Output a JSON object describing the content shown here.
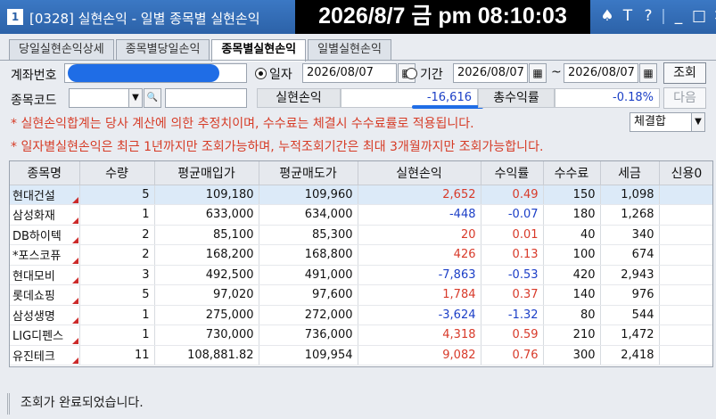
{
  "window": {
    "number": "1",
    "title": "[0328] 실현손익 - 일별 종목별 실현손익",
    "clock": "2026/8/7 금 pm 08:10:03",
    "icons": [
      "font-icon",
      "help-icon",
      "minimize-icon",
      "maximize-icon",
      "close-icon"
    ]
  },
  "tabs": [
    {
      "label": "당일실현손익상세",
      "active": false
    },
    {
      "label": "종목별당일손익",
      "active": false
    },
    {
      "label": "종목별실현손익",
      "active": true
    },
    {
      "label": "일별실현손익",
      "active": false
    }
  ],
  "form": {
    "account_label": "계좌번호",
    "date_radio_label": "일자",
    "date_value": "2026/08/07",
    "period_radio_label": "기간",
    "period_from": "2026/08/07",
    "period_sep": "~",
    "period_to": "2026/08/07",
    "search_button": "조회",
    "code_label": "종목코드",
    "code_value": "",
    "name_value": "",
    "realized_label": "실현손익",
    "realized_value": "-16,616",
    "total_rate_label": "총수익률",
    "total_rate_value": "-0.18%",
    "next_button": "다음",
    "basis_select": "체결합"
  },
  "notices": [
    "* 실현손익합계는 당사 계산에 의한 추정치이며, 수수료는 체결시 수수료률로 적용됩니다.",
    "* 일자별실현손익은 최근 1년까지만 조회가능하며, 누적조회기간은 최대 3개월까지만 조회가능합니다."
  ],
  "table": {
    "columns": [
      "종목명",
      "수량",
      "평균매입가",
      "평균매도가",
      "실현손익",
      "수익률",
      "수수료",
      "세금",
      "신용0"
    ],
    "rows": [
      {
        "name": "현대건설",
        "qty": "5",
        "buy": "109,180",
        "sell": "109,960",
        "pnl": "2,652",
        "rate": "0.49",
        "fee": "150",
        "tax": "1,098",
        "credit": "",
        "sign": "pos"
      },
      {
        "name": "삼성화재",
        "qty": "1",
        "buy": "633,000",
        "sell": "634,000",
        "pnl": "-448",
        "rate": "-0.07",
        "fee": "180",
        "tax": "1,268",
        "credit": "",
        "sign": "neg"
      },
      {
        "name": "DB하이텍",
        "qty": "2",
        "buy": "85,100",
        "sell": "85,300",
        "pnl": "20",
        "rate": "0.01",
        "fee": "40",
        "tax": "340",
        "credit": "",
        "sign": "pos"
      },
      {
        "name": "*포스코퓨",
        "qty": "2",
        "buy": "168,200",
        "sell": "168,800",
        "pnl": "426",
        "rate": "0.13",
        "fee": "100",
        "tax": "674",
        "credit": "",
        "sign": "pos"
      },
      {
        "name": "현대모비",
        "qty": "3",
        "buy": "492,500",
        "sell": "491,000",
        "pnl": "-7,863",
        "rate": "-0.53",
        "fee": "420",
        "tax": "2,943",
        "credit": "",
        "sign": "neg"
      },
      {
        "name": "롯데쇼핑",
        "qty": "5",
        "buy": "97,020",
        "sell": "97,600",
        "pnl": "1,784",
        "rate": "0.37",
        "fee": "140",
        "tax": "976",
        "credit": "",
        "sign": "pos"
      },
      {
        "name": "삼성생명",
        "qty": "1",
        "buy": "275,000",
        "sell": "272,000",
        "pnl": "-3,624",
        "rate": "-1.32",
        "fee": "80",
        "tax": "544",
        "credit": "",
        "sign": "neg"
      },
      {
        "name": "LIG디펜스",
        "qty": "1",
        "buy": "730,000",
        "sell": "736,000",
        "pnl": "4,318",
        "rate": "0.59",
        "fee": "210",
        "tax": "1,472",
        "credit": "",
        "sign": "pos"
      },
      {
        "name": "유진테크",
        "qty": "11",
        "buy": "108,881.82",
        "sell": "109,954",
        "pnl": "9,082",
        "rate": "0.76",
        "fee": "300",
        "tax": "2,418",
        "credit": "",
        "sign": "pos"
      }
    ]
  },
  "status": "조회가 완료되었습니다.",
  "colors": {
    "titlebar": "#2c62a8",
    "positive": "#d83a2a",
    "negative": "#1c3fc7",
    "notice": "#d63b26",
    "selected_row": "#dceaf8"
  }
}
